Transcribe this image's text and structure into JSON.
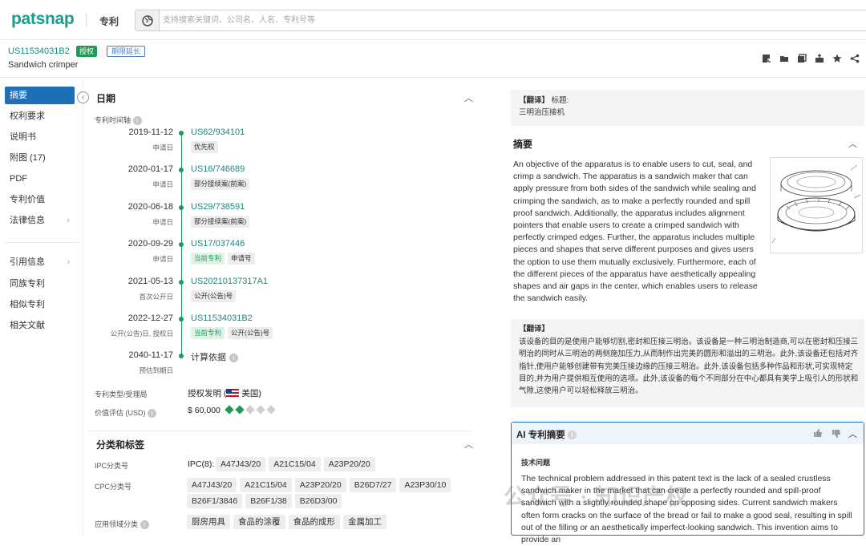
{
  "app": {
    "logo": "patsnap",
    "product": "专利"
  },
  "search": {
    "placeholder": "支持搜索关键词、公司名、人名、专利号等"
  },
  "patent": {
    "number": "US11534031B2",
    "status": "授权",
    "extension": "期限延长",
    "title": "Sandwich crimper"
  },
  "toolbar": {
    "icons": [
      "pdf-download-icon",
      "folder-icon",
      "copy-icon",
      "share-out-icon",
      "star-icon",
      "share-icon"
    ]
  },
  "sidebar": {
    "items": [
      "摘要",
      "权利要求",
      "说明书",
      "附图 (17)",
      "PDF",
      "专利价值",
      "法律信息"
    ],
    "items2": [
      "引用信息",
      "同族专利",
      "相似专利",
      "相关文献"
    ],
    "active": "摘要"
  },
  "dates": {
    "title": "日期",
    "timeline_label": "专利时间轴",
    "events": [
      {
        "date": "2019-11-12",
        "sub": "申请日",
        "number": "US62/934101",
        "tags": [
          "优先权"
        ],
        "green": []
      },
      {
        "date": "2020-01-17",
        "sub": "申请日",
        "number": "US16/746689",
        "tags": [
          "部分接续案(前案)"
        ],
        "green": []
      },
      {
        "date": "2020-06-18",
        "sub": "申请日",
        "number": "US29/738591",
        "tags": [
          "部分接续案(前案)"
        ],
        "green": []
      },
      {
        "date": "2020-09-29",
        "sub": "申请日",
        "number": "US17/037446",
        "tags": [
          "申请号"
        ],
        "green": [
          "当前专利"
        ]
      },
      {
        "date": "2021-05-13",
        "sub": "首次公开日",
        "number": "US20210137317A1",
        "tags": [
          "公开(公告)号"
        ],
        "green": []
      },
      {
        "date": "2022-12-27",
        "sub": "公开(公告)日, 授权日",
        "number": "US11534031B2",
        "tags": [
          "公开(公告)号"
        ],
        "green": [
          "当前专利"
        ]
      },
      {
        "date": "2040-11-17",
        "sub": "预估到期日",
        "number": "计算依据",
        "tags": [],
        "green": []
      }
    ],
    "type_label": "专利类型/受理局",
    "type_value": "授权发明 (",
    "country": "美国",
    "country_close": ")",
    "value_label": "价值评估 (USD)",
    "value": "$ 60,000",
    "value_rating": 2,
    "value_rating_max": 5
  },
  "classification": {
    "title": "分类和标签",
    "ipc_label": "IPC分类号",
    "ipc_prefix": "IPC(8):",
    "ipc": [
      "A47J43/20",
      "A21C15/04",
      "A23P20/20"
    ],
    "cpc_label": "CPC分类号",
    "cpc": [
      "A47J43/20",
      "A21C15/04",
      "A23P20/20",
      "B26D7/27",
      "A23P30/10",
      "B26F1/3846",
      "B26F1/38",
      "B26D3/00"
    ],
    "app_label": "应用领域分类",
    "app": [
      "厨房用具",
      "食品的涂覆",
      "食品的成形",
      "金属加工"
    ]
  },
  "translation_title": {
    "tag": "【翻译】",
    "label": "标题:",
    "text": "三明治压接机"
  },
  "abstract": {
    "title": "摘要",
    "text": "An objective of the apparatus is to enable users to cut, seal, and crimp a sandwich. The apparatus is a sandwich maker that can apply pressure from both sides of the sandwich while sealing and crimping the sandwich, as to make a perfectly rounded and spill proof sandwich. Additionally, the apparatus includes alignment pointers that enable users to create a crimped sandwich with perfectly crimped edges. Further, the apparatus includes multiple pieces and shapes that serve different purposes and gives users the option to use them mutually exclusively. Furthermore, each of the different pieces of the apparatus have aesthetically appealing shapes and air gaps in the center, which enables users to release the sandwich easily."
  },
  "translation_abstract": {
    "tag": "【翻译】",
    "text": "该设备的目的是使用户能够切割,密封和压接三明治。该设备是一种三明治制造商,可以在密封和压接三明治的同时从三明治的两侧施加压力,从而制作出完美的圆形和溢出的三明治。此外,该设备还包括对齐指针,使用户能够创建带有完美压接边缘的压接三明治。此外,该设备包括多种作品和形状,可实现特定目的,并为用户提供相互使用的选项。此外,该设备的每个不同部分在中心都具有美学上吸引人的形状和气隙,这使用户可以轻松释放三明治。"
  },
  "ai": {
    "title": "AI 专利摘要",
    "section": "技术问题",
    "text": "The technical problem addressed in this patent text is the lack of a sealed crustless sandwich maker in the market that can create a perfectly rounded and spill-proof sandwich with a slightly rounded shape on opposing sides. Current sandwich makers often form cracks on the surface of the bread or fail to make a good seal, resulting in spill out of the filling or an aesthetically imperfect-looking sandwich. This invention aims to provide an"
  },
  "watermark": "公众号 · 知识产权"
}
